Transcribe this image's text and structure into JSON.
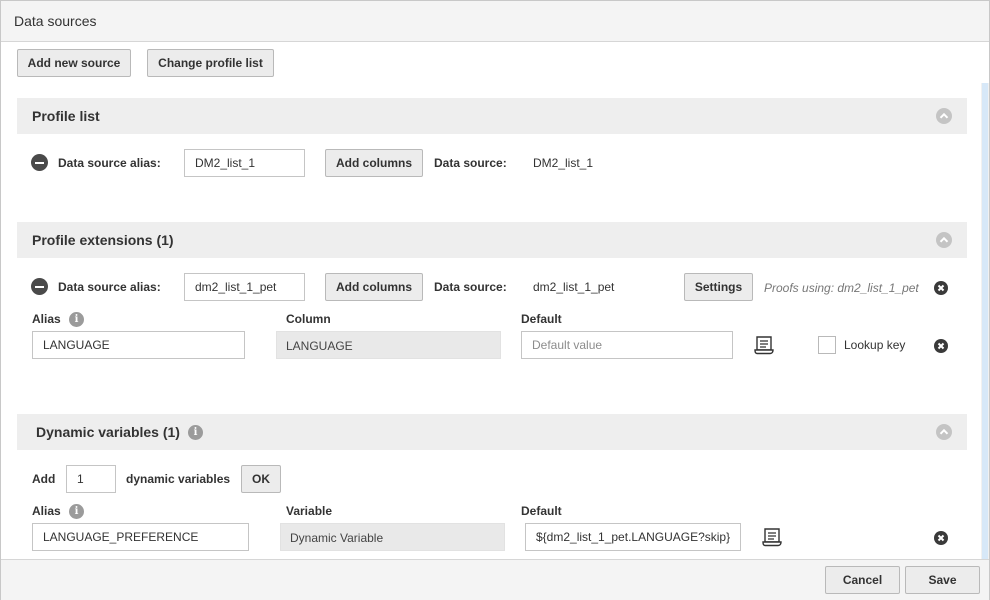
{
  "dialog": {
    "title": "Data sources"
  },
  "toolbar": {
    "add_new_source": "Add new source",
    "change_profile_list": "Change profile list"
  },
  "profile_list": {
    "title": "Profile list",
    "alias_label": "Data source alias:",
    "alias_value": "DM2_list_1",
    "add_columns": "Add columns",
    "data_source_label": "Data source:",
    "data_source_value": "DM2_list_1"
  },
  "profile_extensions": {
    "title": "Profile extensions (1)",
    "alias_label": "Data source alias:",
    "alias_value": "dm2_list_1_pet",
    "add_columns": "Add columns",
    "data_source_label": "Data source:",
    "data_source_value": "dm2_list_1_pet",
    "settings": "Settings",
    "proofs_text": "Proofs using: dm2_list_1_pet",
    "col_headers": {
      "alias": "Alias",
      "column": "Column",
      "default": "Default"
    },
    "row": {
      "alias": "LANGUAGE",
      "column": "LANGUAGE",
      "default_placeholder": "Default value",
      "lookup_key_label": "Lookup key"
    }
  },
  "dynamic_variables": {
    "title": "Dynamic variables (1)",
    "add_label": "Add",
    "count": "1",
    "suffix_label": "dynamic variables",
    "ok": "OK",
    "col_headers": {
      "alias": "Alias",
      "variable": "Variable",
      "default": "Default"
    },
    "row": {
      "alias": "LANGUAGE_PREFERENCE",
      "variable": "Dynamic Variable",
      "default": "${dm2_list_1_pet.LANGUAGE?skip}"
    }
  },
  "footer": {
    "cancel": "Cancel",
    "save": "Save"
  },
  "icons": {
    "collapse": "chevron-up-icon",
    "remove": "minus-circle-icon",
    "delete": "close-circle-icon",
    "info": "info-icon",
    "script": "scroll-icon"
  }
}
